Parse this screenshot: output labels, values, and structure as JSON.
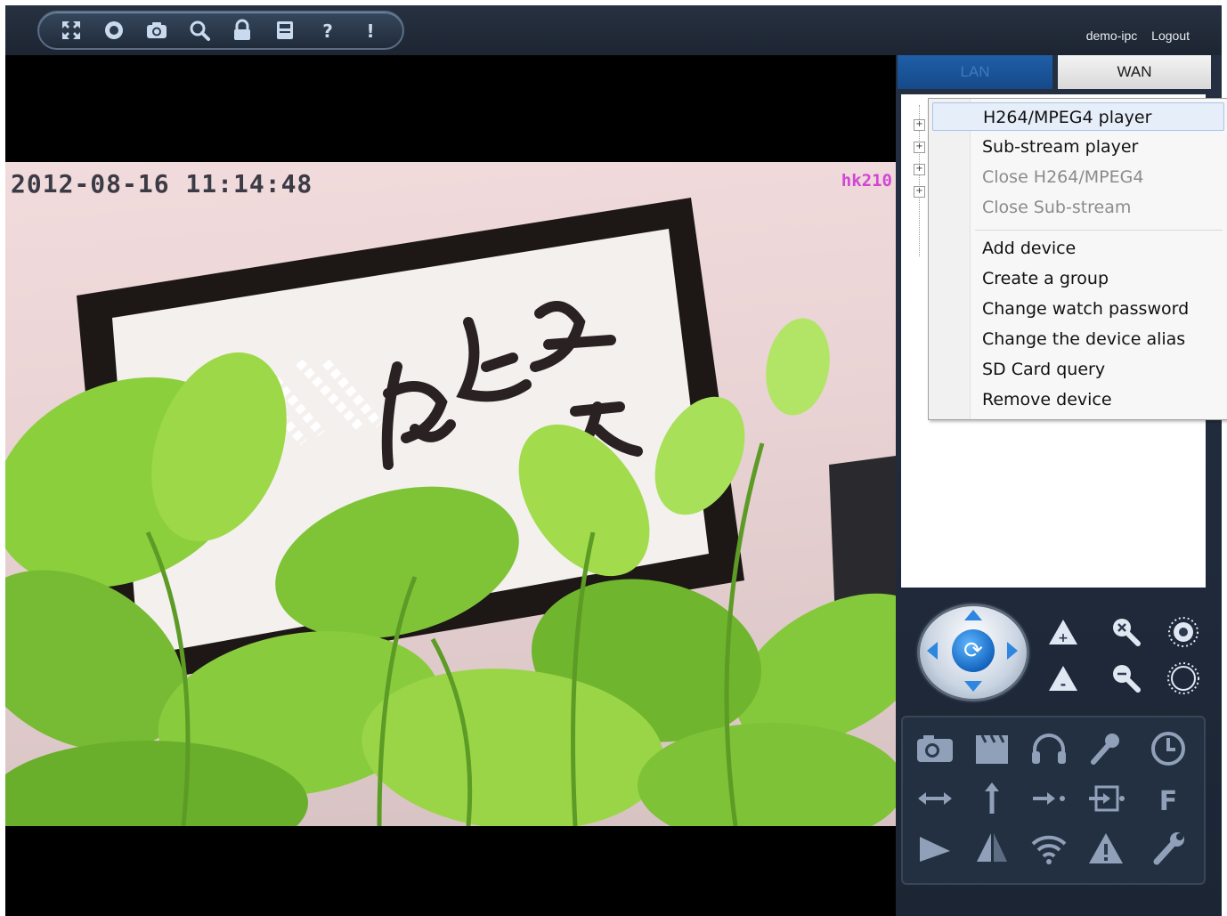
{
  "toolbar": {
    "buttons": [
      {
        "name": "fullscreen-icon"
      },
      {
        "name": "record-icon"
      },
      {
        "name": "snapshot-icon"
      },
      {
        "name": "search-icon"
      },
      {
        "name": "lock-icon"
      },
      {
        "name": "storage-icon"
      },
      {
        "name": "help-icon"
      },
      {
        "name": "info-icon"
      }
    ]
  },
  "user": {
    "name": "demo-ipc",
    "logout_label": "Logout"
  },
  "video": {
    "timestamp": "2012-08-16  11:14:48",
    "camera_label": "hk210"
  },
  "tabs": {
    "lan": "LAN",
    "wan": "WAN"
  },
  "context_menu": {
    "items": [
      {
        "label": "H264/MPEG4 player",
        "state": "highlighted"
      },
      {
        "label": "Sub-stream player",
        "state": "enabled"
      },
      {
        "label": "Close H264/MPEG4",
        "state": "disabled"
      },
      {
        "label": "Close Sub-stream",
        "state": "disabled"
      },
      {
        "label": "Add device",
        "state": "enabled"
      },
      {
        "label": "Create a group",
        "state": "enabled"
      },
      {
        "label": "Change watch password",
        "state": "enabled"
      },
      {
        "label": "Change the device alias",
        "state": "enabled"
      },
      {
        "label": "SD Card query",
        "state": "enabled"
      },
      {
        "label": "Remove device",
        "state": "enabled"
      }
    ]
  },
  "colors": {
    "chrome_dark": "#1a2232",
    "lan_tab": "#1f5ea8",
    "osd_label": "#d246d6",
    "icon_light": "#c9d9ee",
    "ptz_center": "#1466c0"
  },
  "ptz": {
    "icons": [
      "ptz-up-icon",
      "ptz-down-icon",
      "ptz-left-icon",
      "ptz-right-icon",
      "ptz-center-icon",
      "focus-near-icon",
      "zoom-in-icon",
      "iris-open-icon",
      "focus-far-icon",
      "zoom-out-icon",
      "iris-close-icon"
    ]
  },
  "functions": {
    "icons": [
      "camera-snapshot-icon",
      "clapperboard-record-icon",
      "headphones-icon",
      "microphone-icon",
      "power-timer-icon",
      "horizontal-patrol-icon",
      "vertical-patrol-icon",
      "preset-go-icon",
      "input-output-icon",
      "flip-icon",
      "mirror-icon",
      "sail-icon",
      "wifi-icon",
      "alarm-icon",
      "settings-wrench-icon"
    ]
  }
}
